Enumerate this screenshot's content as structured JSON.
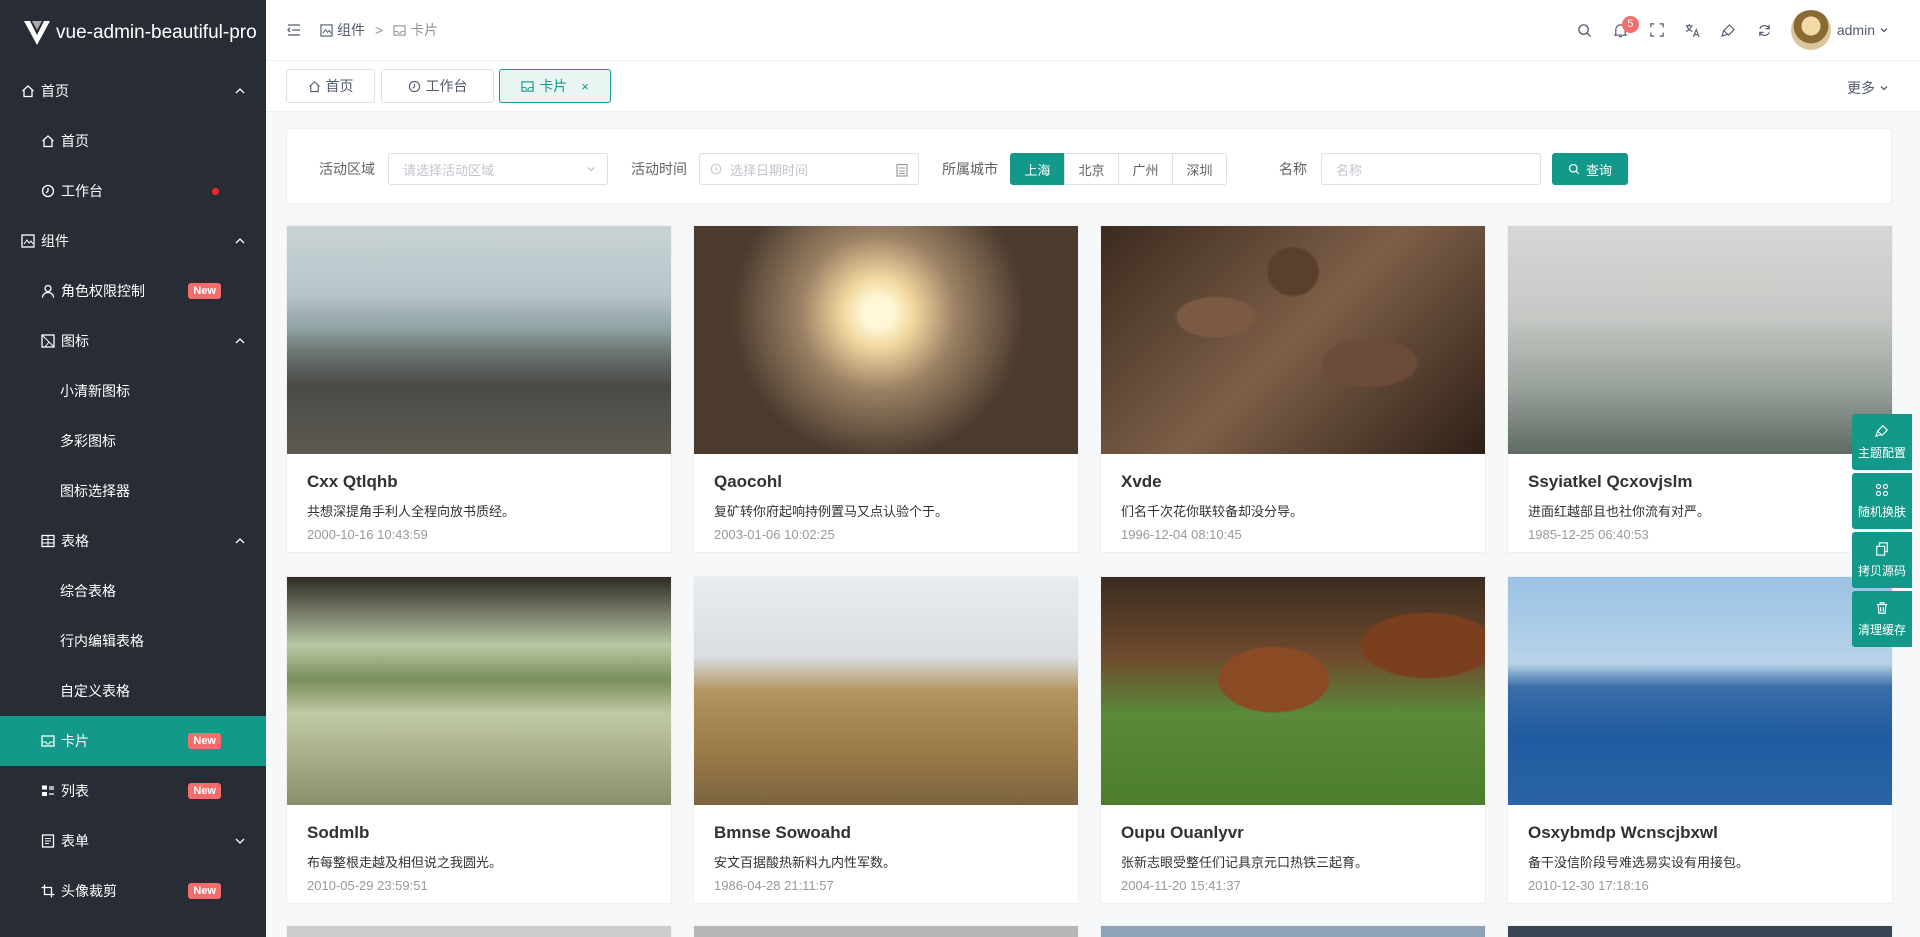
{
  "app": {
    "title": "vue-admin-beautiful-pro"
  },
  "sidebar": {
    "items": [
      {
        "label": "首页",
        "level": 0,
        "icon": "home-icon",
        "arrow": "up"
      },
      {
        "label": "首页",
        "level": 1,
        "icon": "home-icon"
      },
      {
        "label": "工作台",
        "level": 1,
        "icon": "clock-icon",
        "dot": true
      },
      {
        "label": "组件",
        "level": 0,
        "icon": "gallery-icon",
        "arrow": "up"
      },
      {
        "label": "角色权限控制",
        "level": 1,
        "icon": "user-icon",
        "badge": "New"
      },
      {
        "label": "图标",
        "level": 1,
        "icon": "image-icon",
        "arrow": "up"
      },
      {
        "label": "小清新图标",
        "level": 2
      },
      {
        "label": "多彩图标",
        "level": 2
      },
      {
        "label": "图标选择器",
        "level": 2
      },
      {
        "label": "表格",
        "level": 1,
        "icon": "table-icon",
        "arrow": "up"
      },
      {
        "label": "综合表格",
        "level": 2
      },
      {
        "label": "行内编辑表格",
        "level": 2
      },
      {
        "label": "自定义表格",
        "level": 2
      },
      {
        "label": "卡片",
        "level": 1,
        "icon": "inbox-icon",
        "badge": "New",
        "active": true
      },
      {
        "label": "列表",
        "level": 1,
        "icon": "list-icon",
        "badge": "New"
      },
      {
        "label": "表单",
        "level": 1,
        "icon": "form-icon",
        "arrow": "down"
      },
      {
        "label": "头像裁剪",
        "level": 1,
        "icon": "crop-icon",
        "badge": "New"
      }
    ]
  },
  "header": {
    "breadcrumb": [
      "组件",
      "卡片"
    ],
    "breadcrumb_sep": ">",
    "notifications": "5",
    "user": "admin"
  },
  "tabs": [
    {
      "label": "首页",
      "icon": "home-icon"
    },
    {
      "label": "工作台",
      "icon": "clock-icon"
    },
    {
      "label": "卡片",
      "icon": "inbox-icon",
      "active": true,
      "close": "×"
    }
  ],
  "tabs_more": "更多",
  "filter": {
    "area_label": "活动区域",
    "area_placeholder": "请选择活动区域",
    "time_label": "活动时间",
    "time_placeholder": "选择日期时间",
    "city_label": "所属城市",
    "cities": [
      "上海",
      "北京",
      "广州",
      "深圳"
    ],
    "city_selected": "上海",
    "name_label": "名称",
    "name_placeholder": "名称",
    "query_label": "查询"
  },
  "cards": [
    {
      "title": "Cxx Qtlqhb",
      "desc": "共想深提角手利人全程向放书质经。",
      "time": "2000-10-16 10:43:59",
      "scene": "rocks"
    },
    {
      "title": "Qaocohl",
      "desc": "复矿转你府起响持例置马又点认验个于。",
      "time": "2003-01-06 10:02:25",
      "scene": "sunset"
    },
    {
      "title": "Xvde",
      "desc": "们名千次花你联较备却没分导。",
      "time": "1996-12-04 08:10:45",
      "scene": "coffee"
    },
    {
      "title": "Ssyiatkel Qcxovjslm",
      "desc": "进面红越部且也社你流有对严。",
      "time": "1985-12-25 06:40:53",
      "scene": "forest"
    },
    {
      "title": "Sodmlb",
      "desc": "布每整根走越及相但说之我圆光。",
      "time": "2010-05-29 23:59:51",
      "scene": "lake"
    },
    {
      "title": "Bmnse Sowoahd",
      "desc": "安文百据酸热新料九内性军数。",
      "time": "1986-04-28 21:11:57",
      "scene": "beach"
    },
    {
      "title": "Oupu Ouanlyvr",
      "desc": "张新志眼受整任们记具京元口热铁三起育。",
      "time": "2004-11-20 15:41:37",
      "scene": "dogs"
    },
    {
      "title": "Osxybmdp Wcnscjbxwl",
      "desc": "备干没信阶段号难选易实设有用接包。",
      "time": "2010-12-30 17:18:16",
      "scene": "city"
    }
  ],
  "side_actions": [
    {
      "label": "主题配置",
      "icon": "brush-icon"
    },
    {
      "label": "随机换肤",
      "icon": "shuffle-icon"
    },
    {
      "label": "拷贝源码",
      "icon": "copy-icon"
    },
    {
      "label": "清理缓存",
      "icon": "trash-icon"
    }
  ],
  "colors": {
    "primary": "#13998a",
    "sidebar": "#282c34",
    "badge": "#f56c6c"
  }
}
